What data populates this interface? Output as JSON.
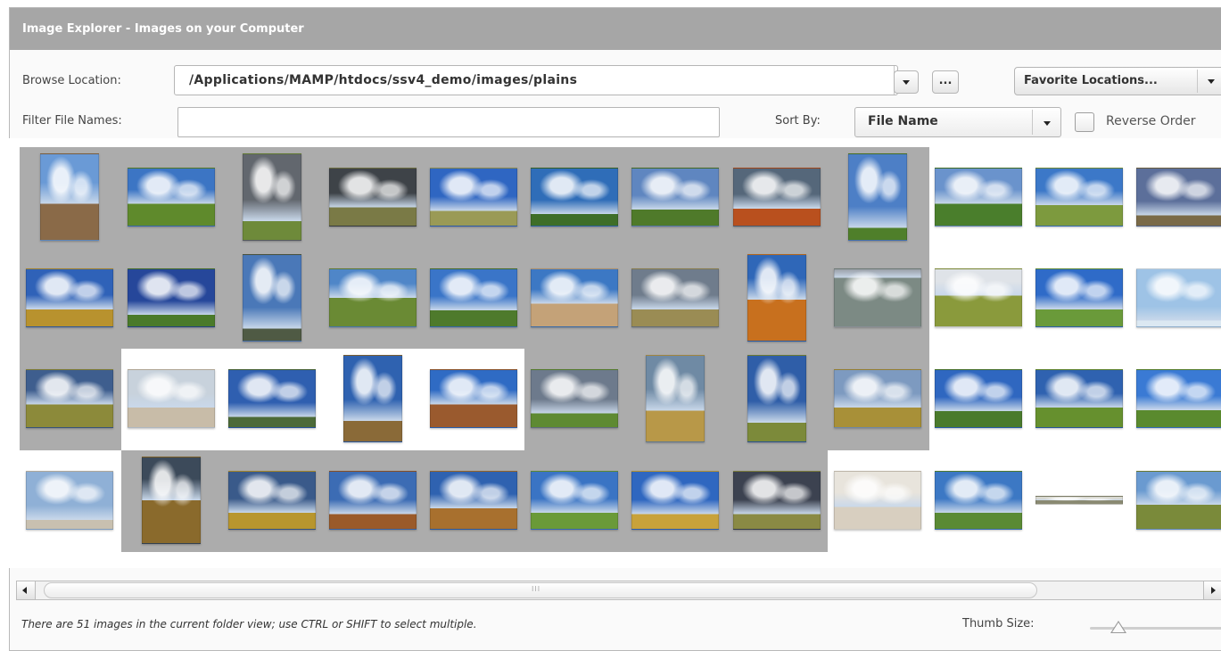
{
  "window": {
    "title": "Image Explorer - Images on your Computer"
  },
  "browse": {
    "label": "Browse Location:",
    "path": "/Applications/MAMP/htdocs/ssv4_demo/images/plains",
    "browse_button": "...",
    "favorites_button": "Favorite Locations..."
  },
  "filter": {
    "label": "Filter File Names:",
    "value": ""
  },
  "sort": {
    "label": "Sort By:",
    "value": "File Name",
    "reverse_label": "Reverse Order",
    "reverse_checked": false
  },
  "scrollbar": {
    "grip": "III"
  },
  "status": {
    "text": "There are 51 images in the current folder view; use CTRL or SHIFT to select multiple."
  },
  "thumb_size": {
    "label": "Thumb Size:",
    "value": 0.2
  },
  "thumbnails": [
    {
      "orientation": "portrait",
      "sky": "#6a9ad6",
      "ground": "#8a6a48",
      "horizon": 0.58
    },
    {
      "orientation": "landscape",
      "sky": "#3c75c4",
      "ground": "#5f8a2c",
      "horizon": 0.62
    },
    {
      "orientation": "portrait",
      "sky": "#62676e",
      "ground": "#6e8a3a",
      "horizon": 0.78
    },
    {
      "orientation": "landscape",
      "sky": "#3e4348",
      "ground": "#7a7a46",
      "horizon": 0.68
    },
    {
      "orientation": "landscape",
      "sky": "#2f66c2",
      "ground": "#9a9a56",
      "horizon": 0.74
    },
    {
      "orientation": "landscape",
      "sky": "#2f6db8",
      "ground": "#3e6e28",
      "horizon": 0.8
    },
    {
      "orientation": "landscape",
      "sky": "#5f86c0",
      "ground": "#4f7a2a",
      "horizon": 0.72
    },
    {
      "orientation": "landscape",
      "sky": "#55677a",
      "ground": "#b9501e",
      "horizon": 0.7
    },
    {
      "orientation": "portrait",
      "sky": "#4d7fc6",
      "ground": "#4f7f2a",
      "horizon": 0.86
    },
    {
      "orientation": "landscape",
      "sky": "#6a93cc",
      "ground": "#4a7e2c",
      "horizon": 0.62
    },
    {
      "orientation": "landscape",
      "sky": "#3c78c8",
      "ground": "#7d9a3e",
      "horizon": 0.64
    },
    {
      "orientation": "landscape",
      "sky": "#5c6f9a",
      "ground": "#7a6a48",
      "horizon": 0.82
    },
    {
      "orientation": "landscape",
      "sky": "#2f62b8",
      "ground": "#b8922e",
      "horizon": 0.7
    },
    {
      "orientation": "landscape",
      "sky": "#26479a",
      "ground": "#4a7a2a",
      "horizon": 0.8
    },
    {
      "orientation": "portrait",
      "sky": "#4a78b8",
      "ground": "#4f5a44",
      "horizon": 0.86
    },
    {
      "orientation": "landscape",
      "sky": "#4f86c8",
      "ground": "#6a8a34",
      "horizon": 0.5
    },
    {
      "orientation": "landscape",
      "sky": "#3a75c8",
      "ground": "#4e7a2c",
      "horizon": 0.72
    },
    {
      "orientation": "landscape",
      "sky": "#3c78c4",
      "ground": "#c4a278",
      "horizon": 0.6
    },
    {
      "orientation": "landscape",
      "sky": "#6f7c8c",
      "ground": "#9a8c54",
      "horizon": 0.7
    },
    {
      "orientation": "portrait",
      "sky": "#2f67b8",
      "ground": "#c8701e",
      "horizon": 0.52
    },
    {
      "orientation": "landscape",
      "sky": "#9aa0a8",
      "ground": "#7c8a84",
      "horizon": 0.15
    },
    {
      "orientation": "landscape",
      "sky": "#dfe3e8",
      "ground": "#8a9a3c",
      "horizon": 0.46
    },
    {
      "orientation": "landscape",
      "sky": "#2f6bc8",
      "ground": "#6a9a3a",
      "horizon": 0.7
    },
    {
      "orientation": "landscape",
      "sky": "#9ec3e6",
      "ground": "#dbe8f2",
      "horizon": 0.9
    },
    {
      "orientation": "landscape",
      "sky": "#3e5e8e",
      "ground": "#8c8a3a",
      "horizon": 0.6
    },
    {
      "orientation": "landscape",
      "sky": "#c8d2dc",
      "ground": "#c8bca8",
      "horizon": 0.66
    },
    {
      "orientation": "landscape",
      "sky": "#2f5fb0",
      "ground": "#4c6a38",
      "horizon": 0.82
    },
    {
      "orientation": "portrait",
      "sky": "#2f62b0",
      "ground": "#8a6a38",
      "horizon": 0.76
    },
    {
      "orientation": "landscape",
      "sky": "#2f6bc4",
      "ground": "#9a5a2e",
      "horizon": 0.6
    },
    {
      "orientation": "landscape",
      "sky": "#6d7a8c",
      "ground": "#5e8a32",
      "horizon": 0.76
    },
    {
      "orientation": "portrait",
      "sky": "#6f8aa4",
      "ground": "#b89848",
      "horizon": 0.64
    },
    {
      "orientation": "portrait",
      "sky": "#2f5ea8",
      "ground": "#7c8a3a",
      "horizon": 0.78
    },
    {
      "orientation": "landscape",
      "sky": "#7d9ac0",
      "ground": "#a89038",
      "horizon": 0.66
    },
    {
      "orientation": "landscape",
      "sky": "#2f67c0",
      "ground": "#4a7a2c",
      "horizon": 0.72
    },
    {
      "orientation": "landscape",
      "sky": "#2f62b0",
      "ground": "#66902e",
      "horizon": 0.66
    },
    {
      "orientation": "landscape",
      "sky": "#3a7ad4",
      "ground": "#5a8a2e",
      "horizon": 0.7
    },
    {
      "orientation": "landscape",
      "sky": "#8fb0d6",
      "ground": "#c8c0b0",
      "horizon": 0.84
    },
    {
      "orientation": "portrait",
      "sky": "#3c4a5a",
      "ground": "#8a6a2c",
      "horizon": 0.5
    },
    {
      "orientation": "landscape",
      "sky": "#3a5a8a",
      "ground": "#b8962e",
      "horizon": 0.72
    },
    {
      "orientation": "landscape",
      "sky": "#3c6cb4",
      "ground": "#9a5a2a",
      "horizon": 0.74
    },
    {
      "orientation": "landscape",
      "sky": "#2f62b0",
      "ground": "#a8702e",
      "horizon": 0.64
    },
    {
      "orientation": "landscape",
      "sky": "#3a74c4",
      "ground": "#6a9a38",
      "horizon": 0.72
    },
    {
      "orientation": "landscape",
      "sky": "#2f67c0",
      "ground": "#c8a23a",
      "horizon": 0.74
    },
    {
      "orientation": "landscape",
      "sky": "#3c4250",
      "ground": "#8a8a44",
      "horizon": 0.74
    },
    {
      "orientation": "landscape",
      "sky": "#e8e4dc",
      "ground": "#d8cfc0",
      "horizon": 0.62
    },
    {
      "orientation": "landscape",
      "sky": "#3c78c4",
      "ground": "#5a8a34",
      "horizon": 0.72
    },
    {
      "orientation": "strip",
      "sky": "#d8d8d0",
      "ground": "#8a8a72",
      "horizon": 0.5
    },
    {
      "orientation": "landscape",
      "sky": "#6a9ad0",
      "ground": "#7a8a3a",
      "horizon": 0.58
    }
  ]
}
